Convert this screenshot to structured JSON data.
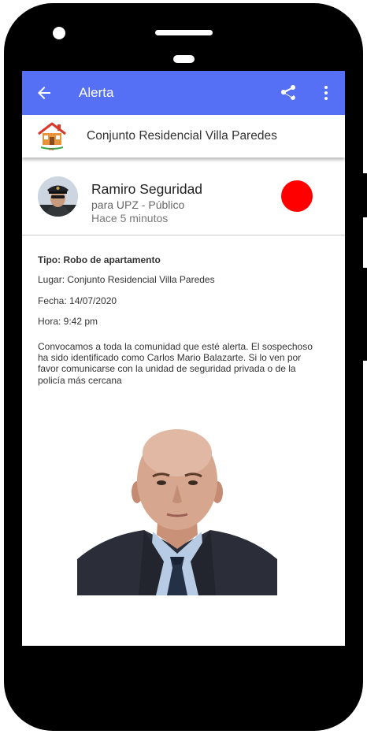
{
  "appbar": {
    "title": "Alerta",
    "back_icon": "arrow-back-icon",
    "share_icon": "share-icon",
    "more_icon": "more-vert-icon",
    "color": "#5670f5"
  },
  "community": {
    "name": "Conjunto Residencial Villa Paredes",
    "logo_icon": "house-logo-icon"
  },
  "author": {
    "name": "Ramiro Seguridad",
    "audience": "para UPZ - Público",
    "time": "Hace 5 minutos",
    "status_color": "#ff0000"
  },
  "alert": {
    "type": "Tipo: Robo de apartamento",
    "place": "Lugar: Conjunto Residencial Villa Paredes",
    "date": "Fecha: 14/07/2020",
    "hour": "Hora: 9:42 pm",
    "message": "Convocamos a toda la comunidad que esté alerta. El sospechoso ha sido identificado como Carlos Mario Balazarte. Si lo ven por favor comunicarse con la unidad de seguridad privada o de la policía más cercana"
  }
}
